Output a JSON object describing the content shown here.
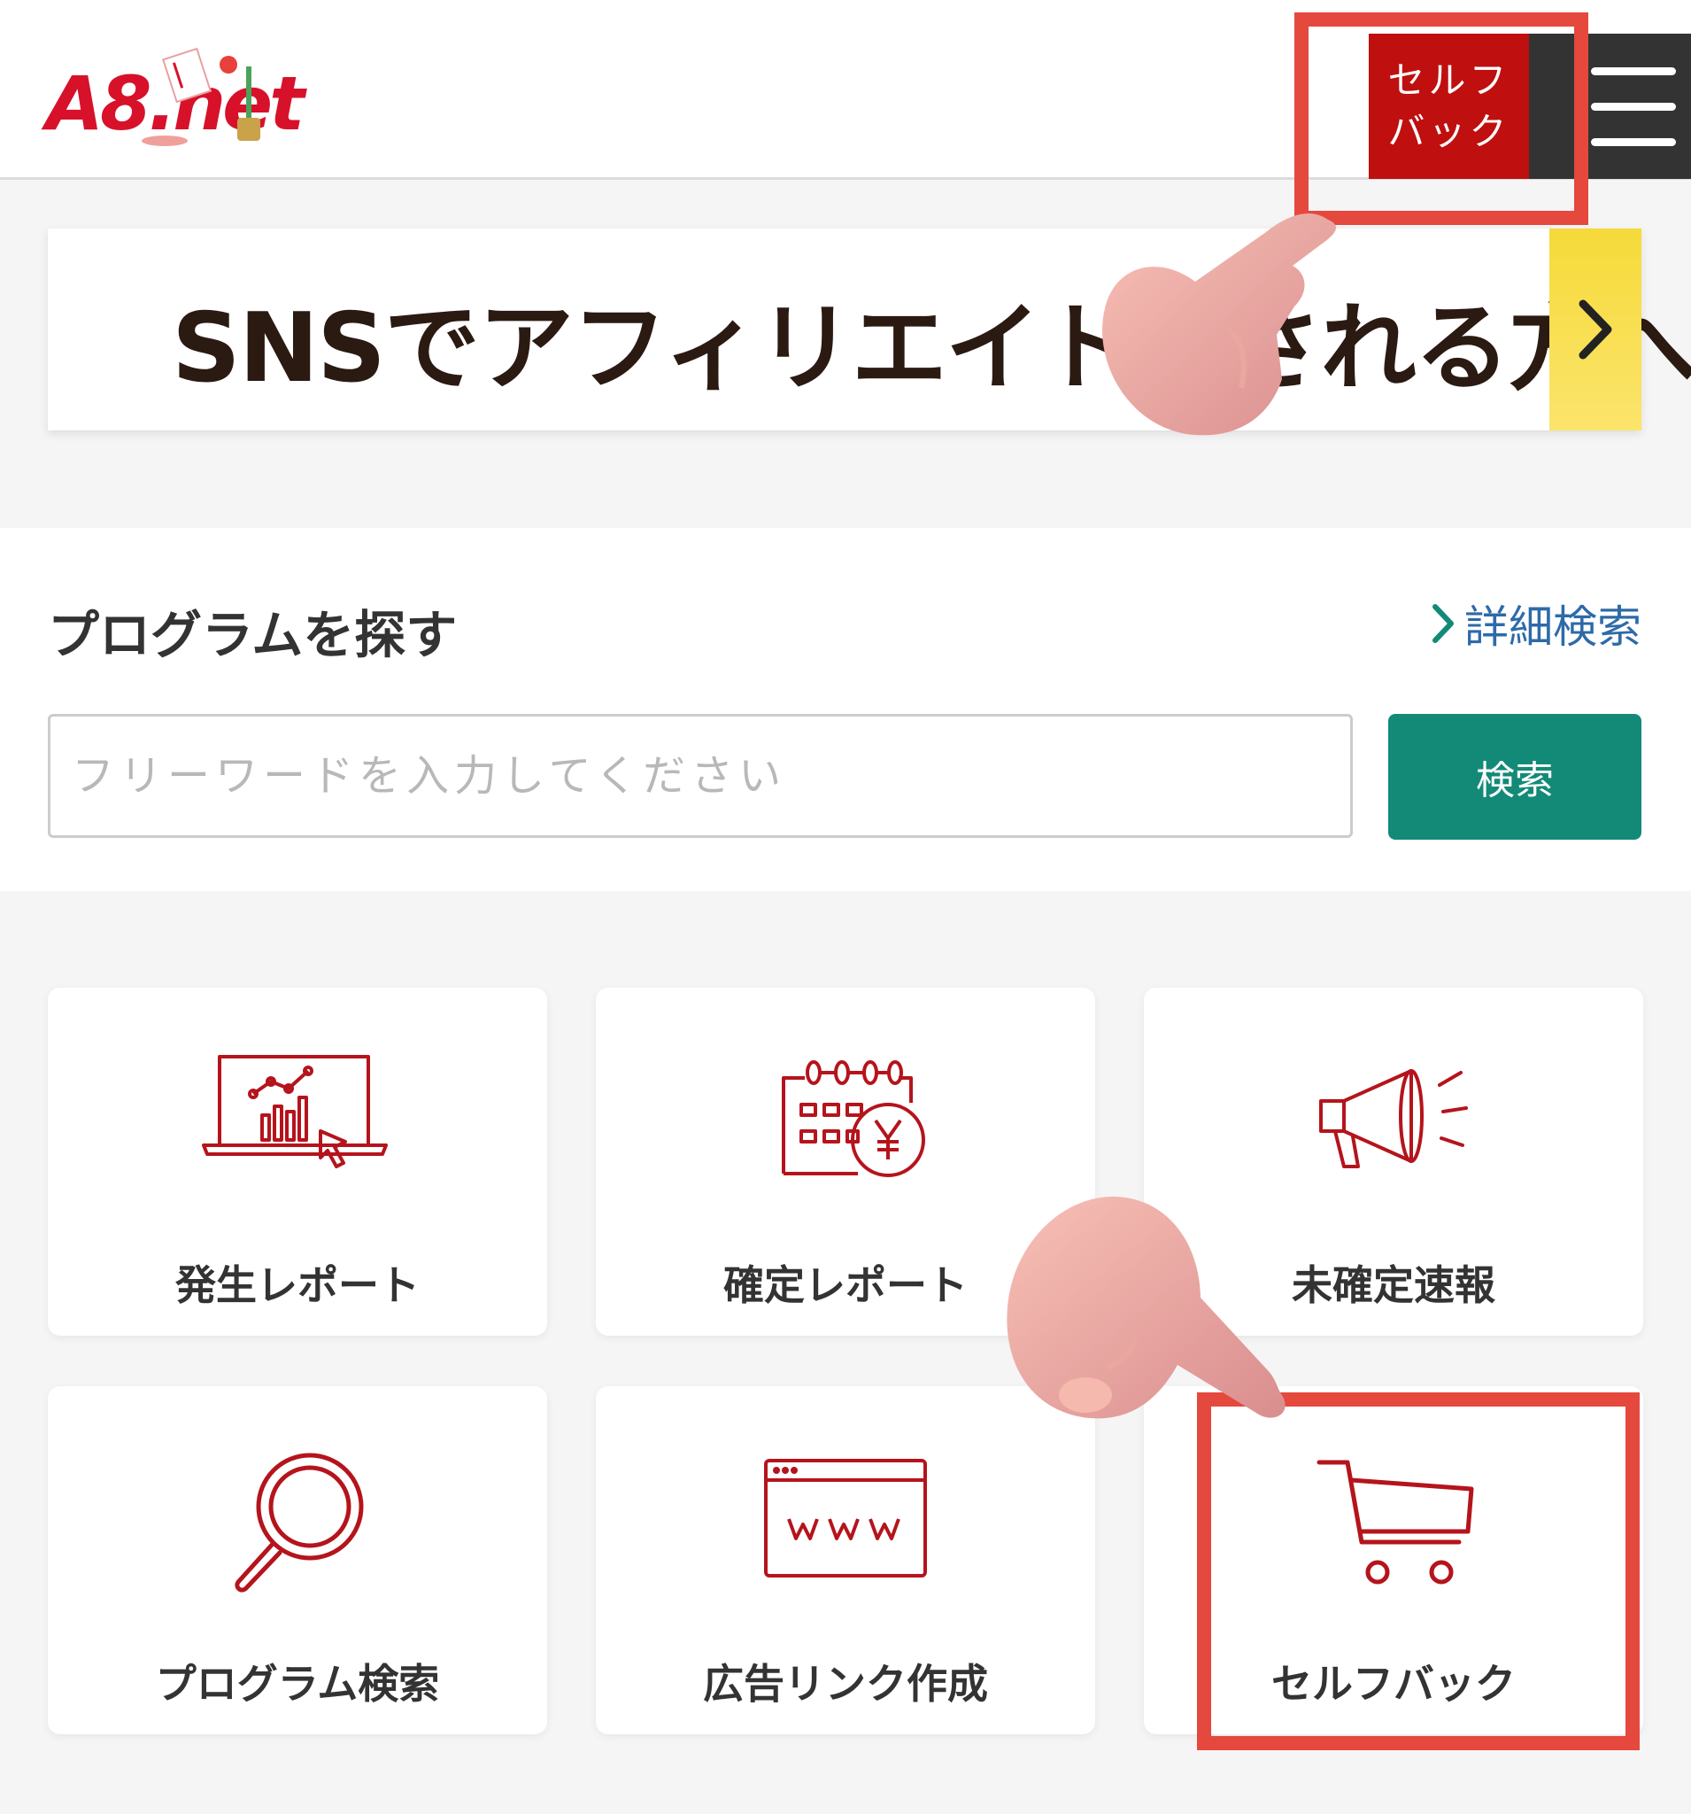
{
  "header": {
    "logo_text": "A8.net",
    "selfback_label_line1": "セルフ",
    "selfback_label_line2": "バック",
    "menu_icon": "hamburger-menu-icon"
  },
  "banner": {
    "text": "SNSでアフィリエイトをされる方へ",
    "arrow_icon": "chevron-right-icon"
  },
  "search": {
    "title": "プログラムを探す",
    "detail_link": "詳細検索",
    "placeholder": "フリーワードを入力してください",
    "button_label": "検索"
  },
  "tiles": [
    {
      "label": "発生レポート",
      "icon": "report-chart-icon"
    },
    {
      "label": "確定レポート",
      "icon": "calendar-yen-icon"
    },
    {
      "label": "未確定速報",
      "icon": "megaphone-icon"
    },
    {
      "label": "プログラム検索",
      "icon": "magnifier-icon"
    },
    {
      "label": "広告リンク作成",
      "icon": "www-browser-icon"
    },
    {
      "label": "セルフバック",
      "icon": "shopping-cart-icon"
    }
  ],
  "colors": {
    "brand_red": "#bf0f0f",
    "icon_red": "#b5141c",
    "search_green": "#138a77",
    "link_blue": "#2e6aa8",
    "highlight": "#e5483d",
    "banner_yellow": "#f6da3a"
  }
}
